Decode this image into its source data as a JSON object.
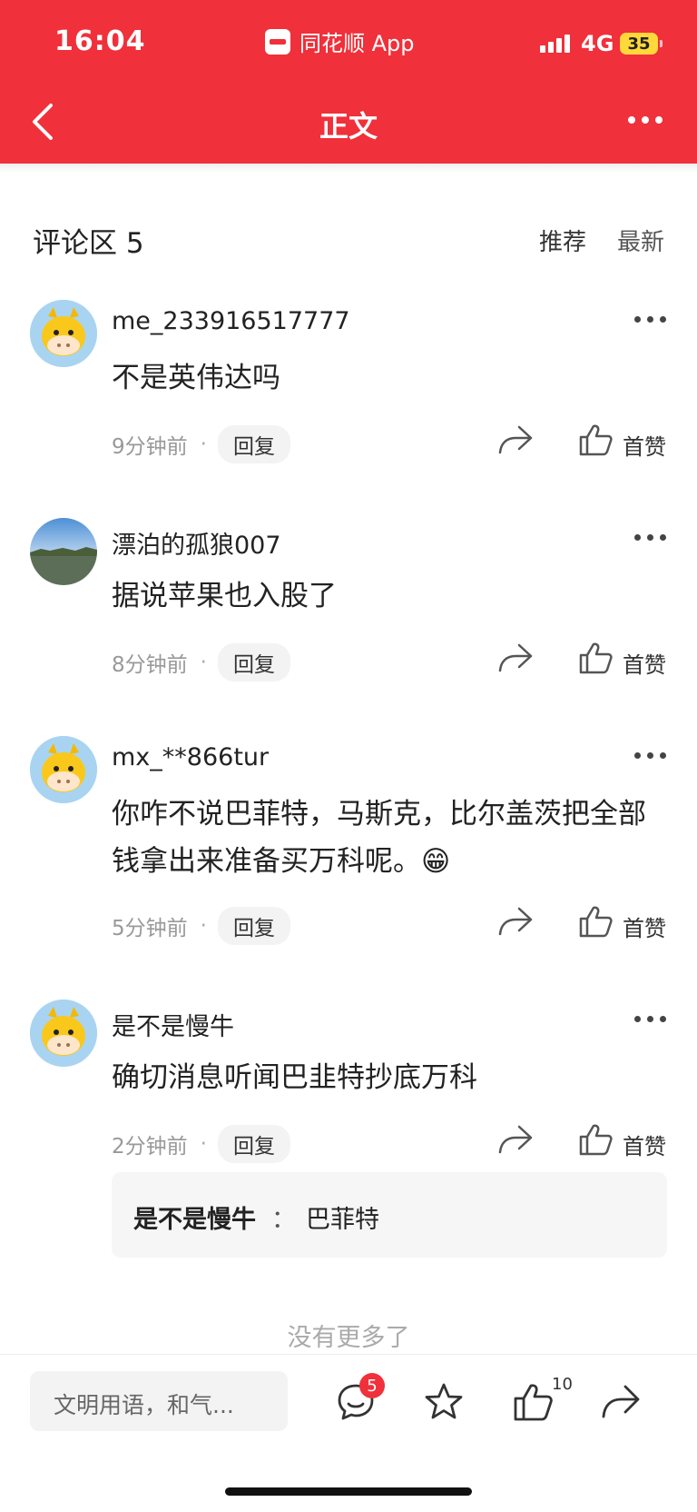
{
  "status_bar": {
    "time": "16:04",
    "app_name": "同花顺 App",
    "network": "4G",
    "battery": "35"
  },
  "nav": {
    "title": "正文",
    "back_icon": "chevron-left-icon",
    "more_icon": "more-horizontal-icon"
  },
  "comments_header": {
    "title": "评论区 5",
    "sort_recommend": "推荐",
    "sort_latest": "最新"
  },
  "comments": [
    {
      "user": "me_233916517777",
      "text": "不是英伟达吗",
      "time": "9分钟前",
      "reply_label": "回复",
      "like_label": "首赞",
      "avatar": "cow-avatar"
    },
    {
      "user": "漂泊的孤狼007",
      "text": "据说苹果也入股了",
      "time": "8分钟前",
      "reply_label": "回复",
      "like_label": "首赞",
      "avatar": "lake-photo-avatar"
    },
    {
      "user": "mx_**866tur",
      "text": "你咋不说巴菲特，马斯克，比尔盖茨把全部钱拿出来准备买万科呢。😁",
      "time": "5分钟前",
      "reply_label": "回复",
      "like_label": "首赞",
      "avatar": "cow-avatar"
    },
    {
      "user": "是不是慢牛",
      "text": "确切消息听闻巴韭特抄底万科",
      "time": "2分钟前",
      "reply_label": "回复",
      "like_label": "首赞",
      "avatar": "cow-avatar",
      "sub_reply": {
        "user": "是不是慢牛",
        "separator": "：",
        "text": "巴菲特"
      }
    }
  ],
  "footer": {
    "no_more": "没有更多了"
  },
  "bottom_bar": {
    "input_placeholder": "文明用语，和气...",
    "comment_badge": "5",
    "like_count": "10"
  },
  "colors": {
    "brand_red": "#f0303a",
    "battery_yellow": "#ffd83a"
  }
}
